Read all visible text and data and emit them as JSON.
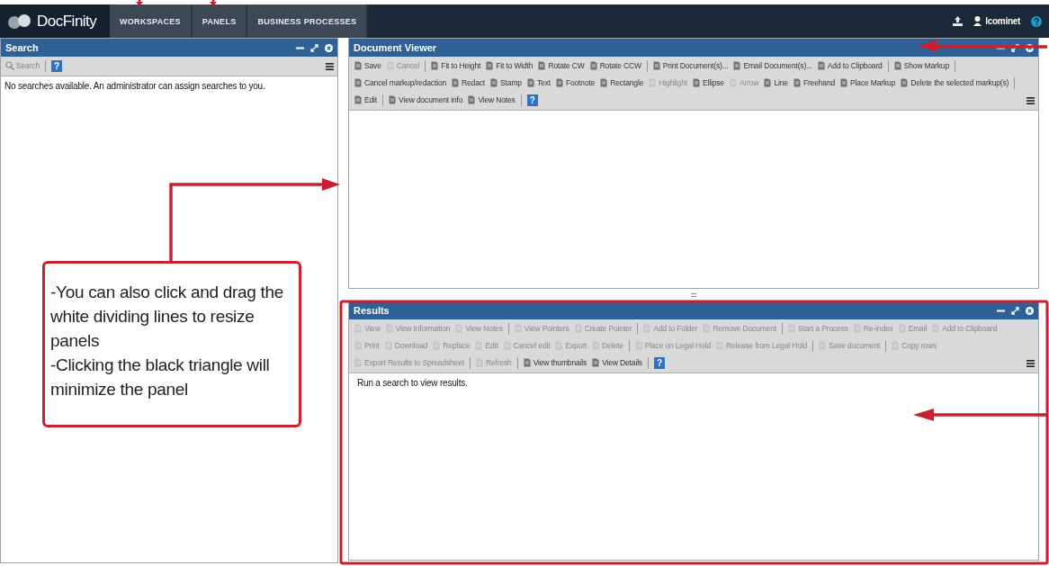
{
  "app": {
    "logo": "DocFinity",
    "nav_tabs": [
      {
        "label": "WORKSPACES"
      },
      {
        "label": "PANELS"
      },
      {
        "label": "BUSINESS PROCESSES"
      }
    ],
    "user": "lcominet"
  },
  "search_panel": {
    "title": "Search",
    "toolbar": [
      {
        "kind": "tool",
        "label": "Search",
        "disabled": true
      },
      {
        "kind": "separator"
      },
      {
        "kind": "help",
        "label": "?"
      }
    ],
    "message": "No searches available. An administrator can assign searches to you."
  },
  "document_viewer": {
    "title": "Document Viewer",
    "toolbar": [
      {
        "kind": "tool",
        "label": "Save",
        "disabled": false
      },
      {
        "kind": "tool",
        "label": "Cancel",
        "disabled": true
      },
      {
        "kind": "separator"
      },
      {
        "kind": "tool",
        "label": "Fit to Height",
        "disabled": false
      },
      {
        "kind": "tool",
        "label": "Fit to Width",
        "disabled": false
      },
      {
        "kind": "tool",
        "label": "Rotate CW",
        "disabled": false
      },
      {
        "kind": "tool",
        "label": "Rotate CCW",
        "disabled": false
      },
      {
        "kind": "separator"
      },
      {
        "kind": "tool",
        "label": "Print Document(s)...",
        "disabled": false
      },
      {
        "kind": "tool",
        "label": "Email Document(s)...",
        "disabled": false
      },
      {
        "kind": "tool",
        "label": "Add to Clipboard",
        "disabled": false
      },
      {
        "kind": "separator"
      },
      {
        "kind": "tool",
        "label": "Show Markup",
        "disabled": false
      },
      {
        "kind": "separator"
      },
      {
        "kind": "tool",
        "label": "Cancel markup/redaction",
        "disabled": false
      },
      {
        "kind": "tool",
        "label": "Redact",
        "disabled": false
      },
      {
        "kind": "tool",
        "label": "Stamp",
        "disabled": false
      },
      {
        "kind": "tool",
        "label": "Text",
        "disabled": false
      },
      {
        "kind": "tool",
        "label": "Footnote",
        "disabled": false
      },
      {
        "kind": "tool",
        "label": "Rectangle",
        "disabled": false
      },
      {
        "kind": "tool",
        "label": "Highlight",
        "disabled": true
      },
      {
        "kind": "tool",
        "label": "Ellipse",
        "disabled": false
      },
      {
        "kind": "tool",
        "label": "Arrow",
        "disabled": true
      },
      {
        "kind": "tool",
        "label": "Line",
        "disabled": false
      },
      {
        "kind": "tool",
        "label": "Freehand",
        "disabled": false
      },
      {
        "kind": "tool",
        "label": "Place Markup",
        "disabled": false
      },
      {
        "kind": "tool",
        "label": "Delete the selected markup(s)",
        "disabled": false
      },
      {
        "kind": "separator"
      },
      {
        "kind": "tool",
        "label": "Edit",
        "disabled": false
      },
      {
        "kind": "separator"
      },
      {
        "kind": "tool",
        "label": "View document info",
        "disabled": false
      },
      {
        "kind": "tool",
        "label": "View Notes",
        "disabled": false
      },
      {
        "kind": "separator"
      },
      {
        "kind": "help",
        "label": "?"
      }
    ]
  },
  "results": {
    "title": "Results",
    "toolbar": [
      {
        "kind": "tool",
        "label": "View",
        "disabled": true
      },
      {
        "kind": "tool",
        "label": "View Information",
        "disabled": true
      },
      {
        "kind": "tool",
        "label": "View Notes",
        "disabled": true
      },
      {
        "kind": "separator"
      },
      {
        "kind": "tool",
        "label": "View Pointers",
        "disabled": true
      },
      {
        "kind": "tool",
        "label": "Create Pointer",
        "disabled": true
      },
      {
        "kind": "separator"
      },
      {
        "kind": "tool",
        "label": "Add to Folder",
        "disabled": true
      },
      {
        "kind": "tool",
        "label": "Remove Document",
        "disabled": true
      },
      {
        "kind": "separator"
      },
      {
        "kind": "tool",
        "label": "Start a Process",
        "disabled": true
      },
      {
        "kind": "tool",
        "label": "Re-index",
        "disabled": true
      },
      {
        "kind": "tool",
        "label": "Email",
        "disabled": true
      },
      {
        "kind": "tool",
        "label": "Add to Clipboard",
        "disabled": true
      },
      {
        "kind": "tool",
        "label": "Print",
        "disabled": true
      },
      {
        "kind": "tool",
        "label": "Download",
        "disabled": true
      },
      {
        "kind": "tool",
        "label": "Replace",
        "disabled": true
      },
      {
        "kind": "tool",
        "label": "Edit",
        "disabled": true
      },
      {
        "kind": "tool",
        "label": "Cancel edit",
        "disabled": true
      },
      {
        "kind": "tool",
        "label": "Export",
        "disabled": true
      },
      {
        "kind": "tool",
        "label": "Delete",
        "disabled": true
      },
      {
        "kind": "separator"
      },
      {
        "kind": "tool",
        "label": "Place on Legal Hold",
        "disabled": true
      },
      {
        "kind": "tool",
        "label": "Release from Legal Hold",
        "disabled": true
      },
      {
        "kind": "separator"
      },
      {
        "kind": "tool",
        "label": "Save document",
        "disabled": true
      },
      {
        "kind": "separator"
      },
      {
        "kind": "tool",
        "label": "Copy rows",
        "disabled": true
      },
      {
        "kind": "tool",
        "label": "Export Results to Spreadsheet",
        "disabled": true
      },
      {
        "kind": "separator"
      },
      {
        "kind": "tool",
        "label": "Refresh",
        "disabled": true
      },
      {
        "kind": "separator"
      },
      {
        "kind": "tool",
        "label": "View thumbnails",
        "disabled": false
      },
      {
        "kind": "tool",
        "label": "View Details",
        "disabled": false
      },
      {
        "kind": "separator"
      },
      {
        "kind": "help",
        "label": "?"
      }
    ],
    "message": "Run a search to view results."
  },
  "annotation": {
    "callout": [
      "-You can also click and drag the white dividing lines to resize panels",
      "-Clicking the black triangle will minimize the panel"
    ]
  }
}
